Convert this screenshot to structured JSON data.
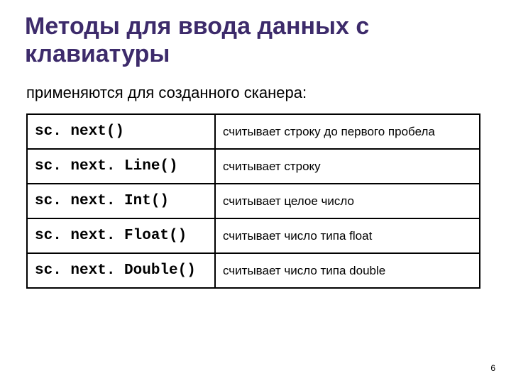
{
  "title": "Методы для ввода данных с клавиатуры",
  "subtitle": "применяются для созданного сканера:",
  "rows": [
    {
      "method": "sc. next()",
      "desc": "считывает строку до первого пробела"
    },
    {
      "method": "sc. next. Line()",
      "desc": "считывает строку"
    },
    {
      "method": "sc. next. Int()",
      "desc": "считывает целое число"
    },
    {
      "method": "sc. next. Float()",
      "desc": "считывает число типа float"
    },
    {
      "method": "sc. next. Double()",
      "desc": "считывает число типа double"
    }
  ],
  "page_number": "6"
}
